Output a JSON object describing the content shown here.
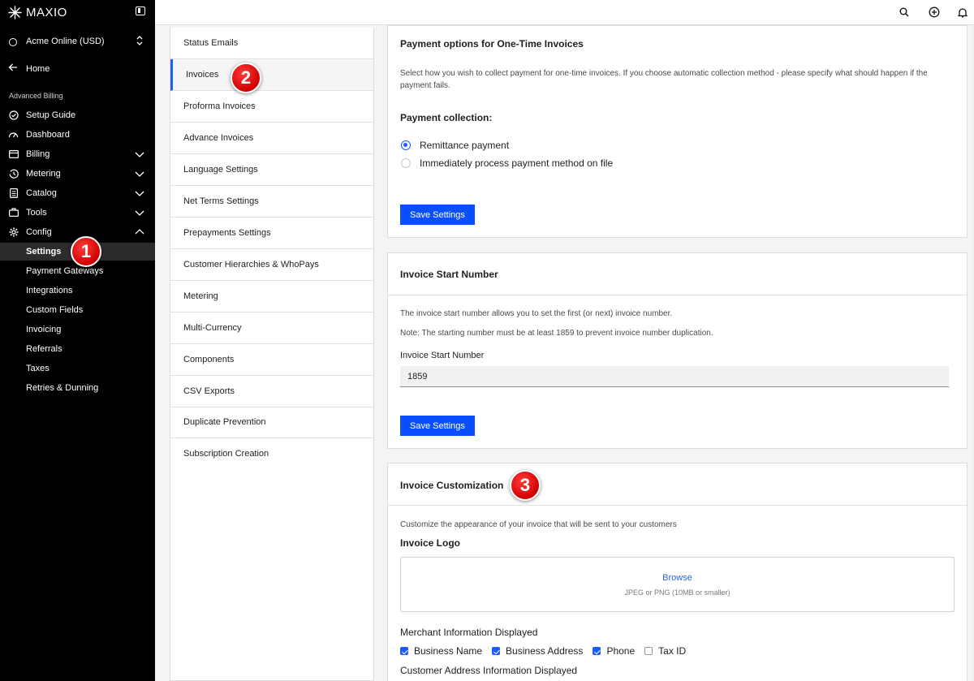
{
  "brand": {
    "name": "MAXIO"
  },
  "account": {
    "name": "Acme Online (USD)"
  },
  "sidebar": {
    "home": "Home",
    "section_title": "Advanced Billing",
    "items": [
      {
        "label": "Setup Guide"
      },
      {
        "label": "Dashboard"
      },
      {
        "label": "Billing"
      },
      {
        "label": "Metering"
      },
      {
        "label": "Catalog"
      },
      {
        "label": "Tools"
      },
      {
        "label": "Config"
      }
    ],
    "sub_items": [
      {
        "label": "Settings"
      },
      {
        "label": "Payment Gateways"
      },
      {
        "label": "Integrations"
      },
      {
        "label": "Custom Fields"
      },
      {
        "label": "Invoicing"
      },
      {
        "label": "Referrals"
      },
      {
        "label": "Taxes"
      },
      {
        "label": "Retries & Dunning"
      }
    ]
  },
  "markers": {
    "one": "1",
    "two": "2",
    "three": "3"
  },
  "settings_menu": [
    {
      "label": "Status Emails"
    },
    {
      "label": "Invoices"
    },
    {
      "label": "Proforma Invoices"
    },
    {
      "label": "Advance Invoices"
    },
    {
      "label": "Language Settings"
    },
    {
      "label": "Net Terms Settings"
    },
    {
      "label": "Prepayments Settings"
    },
    {
      "label": "Customer Hierarchies & WhoPays"
    },
    {
      "label": "Metering"
    },
    {
      "label": "Multi-Currency"
    },
    {
      "label": "Components"
    },
    {
      "label": "CSV Exports"
    },
    {
      "label": "Duplicate Prevention"
    },
    {
      "label": "Subscription Creation"
    }
  ],
  "payment_options": {
    "title": "Payment options for One-Time Invoices",
    "description": "Select how you wish to collect payment for one-time invoices. If you choose automatic collection method - please specify what should happen if the payment fails.",
    "collection_label": "Payment collection:",
    "options": [
      {
        "label": "Remittance payment",
        "selected": true
      },
      {
        "label": "Immediately process payment method on file",
        "selected": false
      }
    ],
    "save_label": "Save Settings"
  },
  "invoice_start": {
    "title": "Invoice Start Number",
    "description": "The invoice start number allows you to set the first (or next) invoice number.",
    "note": "Note: The starting number must be at least 1859 to prevent invoice number duplication.",
    "field_label": "Invoice Start Number",
    "value": "1859",
    "save_label": "Save Settings"
  },
  "customization": {
    "title": "Invoice Customization",
    "description": "Customize the appearance of your invoice that will be sent to your customers",
    "logo_label": "Invoice Logo",
    "browse": "Browse",
    "hint": "JPEG or PNG (10MB or smaller)",
    "merchant_label": "Merchant Information Displayed",
    "merchant_options": [
      {
        "label": "Business Name",
        "checked": true
      },
      {
        "label": "Business Address",
        "checked": true
      },
      {
        "label": "Phone",
        "checked": true
      },
      {
        "label": "Tax ID",
        "checked": false
      }
    ],
    "customer_label": "Customer Address Information Displayed"
  },
  "colors": {
    "accent": "#0a4fff",
    "sidebar_bg": "#000000",
    "badge": "#e00000"
  }
}
